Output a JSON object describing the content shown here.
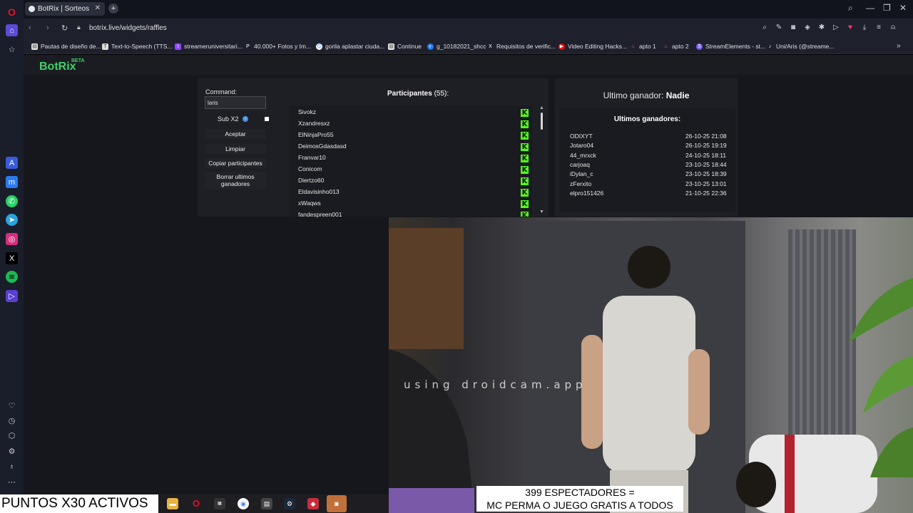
{
  "browser": {
    "tab_title": "BotRix | Sorteos",
    "url": "botrix.live/widgets/raffles",
    "bookmarks": [
      "Pautas de diseño de...",
      "Text-to-Speech (TTS...",
      "streameruniversitari...",
      "40.000+ Fotos y Im...",
      "gorila aplastar ciuda...",
      "Continue",
      "g_10182021_shcc",
      "Requisitos de verific...",
      "Video Editing Hacks...",
      "apto 1",
      "apto 2",
      "StreamElements - st...",
      "Uni/Aris (@streame..."
    ]
  },
  "app": {
    "logo": "BotRix",
    "badge": "BETA"
  },
  "raffle": {
    "command_label": "Command:",
    "command_value": "laris",
    "sub_label": "Sub X2",
    "buttons": [
      "Aceptar",
      "Limpiar",
      "Copiar participantes",
      "Borrar ultimos ganadores"
    ]
  },
  "participants": {
    "title": "Participantes",
    "count": "(55):",
    "names": [
      "Sivokz",
      "Xzandresxz",
      "ElNinjaPro55",
      "DeimosGdasdasd",
      "Franvar10",
      "Conicom",
      "Diertzo60",
      "Eldavisinho013",
      "xWaqws",
      "fandespreen001"
    ],
    "platform_badge": "K"
  },
  "winners": {
    "last_label": "Ultimo ganador:",
    "last_name": "Nadie",
    "title": "Ultimos ganadores:",
    "rows": [
      {
        "name": "ODIXYT",
        "date": "26-10-25 21:08"
      },
      {
        "name": "Jotaro04",
        "date": "26-10-25 19:19"
      },
      {
        "name": "44_mrxck",
        "date": "24-10-25 18:11"
      },
      {
        "name": "carjoaq",
        "date": "23-10-25 18:44"
      },
      {
        "name": "iDylan_c",
        "date": "23-10-25 18:39"
      },
      {
        "name": "zFerxito",
        "date": "23-10-25 13:01"
      },
      {
        "name": "elpro151426",
        "date": "21-10-25 22:36"
      }
    ]
  },
  "stream": {
    "watermark": "using droidcam.app",
    "puntos": "PUNTOS X30 ACTIVOS",
    "espectadores_line1": "399 ESPECTADORES =",
    "espectadores_line2": "MC PERMA O JUEGO GRATIS A TODOS"
  },
  "colors": {
    "kick_green": "#53fc18",
    "botrix_green": "#3dd36a",
    "opera_red": "#e0162b"
  }
}
